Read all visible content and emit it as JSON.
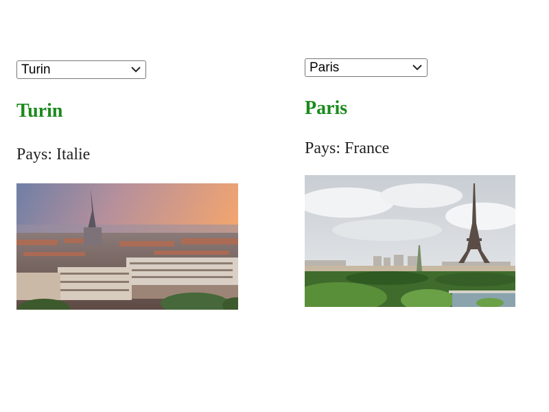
{
  "accent_color": "#1b8a1b",
  "left": {
    "select": {
      "value": "Turin",
      "options": [
        "Turin"
      ]
    },
    "city_name": "Turin",
    "country_label": "Pays: Italie"
  },
  "right": {
    "select": {
      "value": "Paris",
      "options": [
        "Paris"
      ]
    },
    "city_name": "Paris",
    "country_label": "Pays: France"
  }
}
